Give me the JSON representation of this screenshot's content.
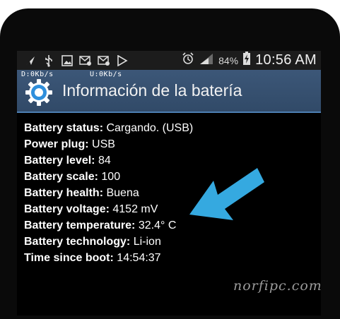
{
  "status_bar": {
    "battery_percent": "84%",
    "time": "10:56 AM",
    "left_icons": [
      "navigation-icon",
      "usb-icon",
      "image-icon",
      "mail-icon",
      "mail-icon",
      "play-store-icon"
    ],
    "right_icons": [
      "alarm-icon",
      "signal-icon",
      "battery-charging-icon"
    ]
  },
  "net": {
    "down": "D:0Kb/s",
    "up": "U:0Kb/s"
  },
  "app": {
    "title": "Información de la batería"
  },
  "info": [
    {
      "label": "Battery status:",
      "value": "Cargando. (USB)"
    },
    {
      "label": "Power plug:",
      "value": "USB"
    },
    {
      "label": "Battery level:",
      "value": "84"
    },
    {
      "label": "Battery scale:",
      "value": "100"
    },
    {
      "label": "Battery health:",
      "value": "Buena"
    },
    {
      "label": "Battery voltage:",
      "value": "4152 mV"
    },
    {
      "label": "Battery temperature:",
      "value": "32.4° C"
    },
    {
      "label": "Battery technology:",
      "value": "Li-ion"
    },
    {
      "label": "Time since boot:",
      "value": "14:54:37"
    }
  ],
  "watermark": "norfipc.com",
  "colors": {
    "titlebar": "#34506f",
    "accent_arrow": "#35a9e0",
    "gear": "#2f8fdc"
  }
}
